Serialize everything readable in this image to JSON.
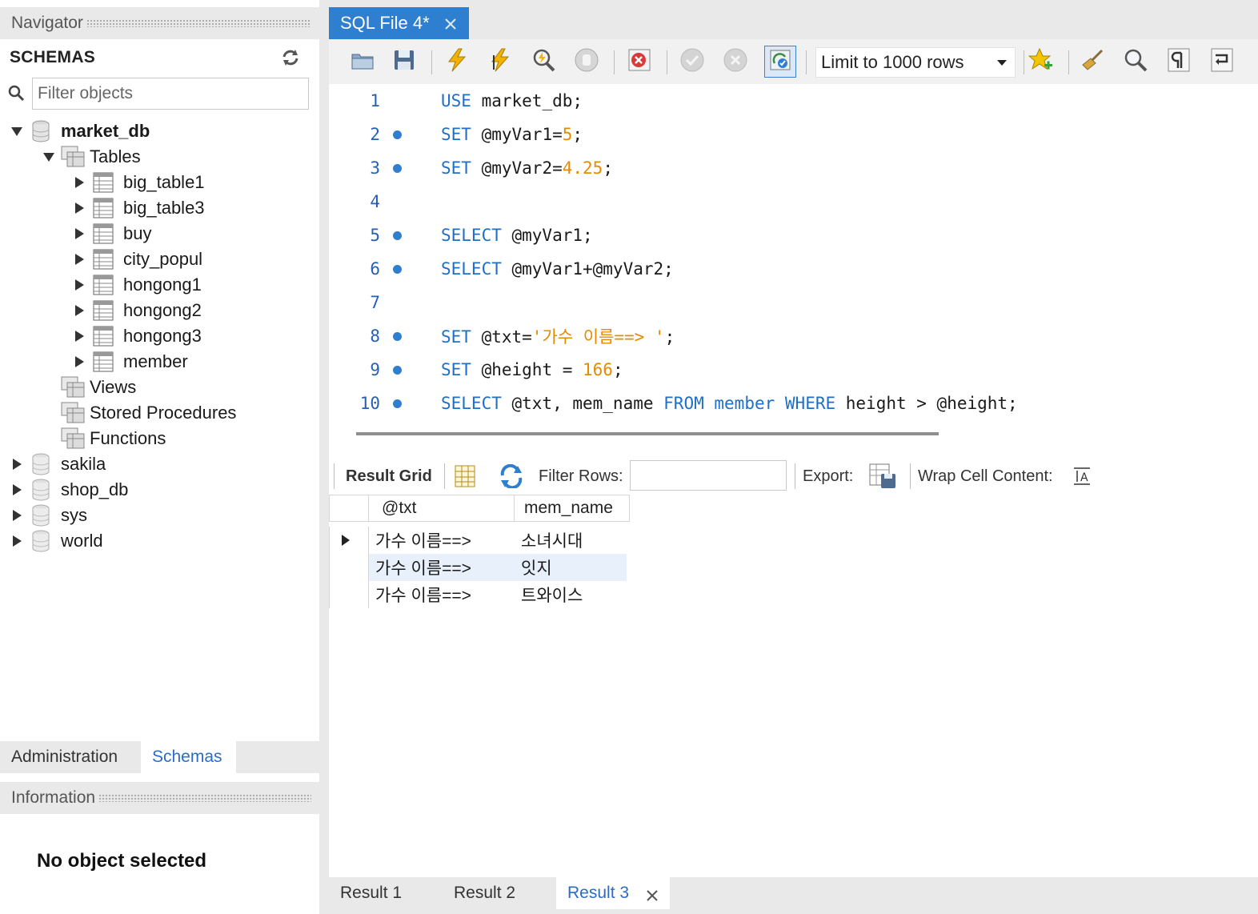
{
  "navigator": {
    "header": "Navigator",
    "schemas_title": "SCHEMAS",
    "filter_placeholder": "Filter objects",
    "tree": {
      "db_market": "market_db",
      "tables_label": "Tables",
      "tables": [
        "big_table1",
        "big_table3",
        "buy",
        "city_popul",
        "hongong1",
        "hongong2",
        "hongong3",
        "member"
      ],
      "views_label": "Views",
      "procs_label": "Stored Procedures",
      "funcs_label": "Functions",
      "other_dbs": [
        "sakila",
        "shop_db",
        "sys",
        "world"
      ]
    },
    "bottom_tabs": {
      "admin": "Administration",
      "schemas": "Schemas"
    },
    "info_header": "Information",
    "info_text": "No object selected"
  },
  "editor_tab": {
    "title": "SQL File 4*"
  },
  "toolbar": {
    "limit": "Limit to 1000 rows"
  },
  "editor": {
    "lines": [
      {
        "n": "1",
        "parts": [
          [
            "kw",
            "USE"
          ],
          [
            "p",
            " market_db;"
          ]
        ],
        "dot": false
      },
      {
        "n": "2",
        "parts": [
          [
            "kw",
            "SET"
          ],
          [
            "p",
            " @myVar1="
          ],
          [
            "num",
            "5"
          ],
          [
            "p",
            ";"
          ]
        ],
        "dot": true
      },
      {
        "n": "3",
        "parts": [
          [
            "kw",
            "SET"
          ],
          [
            "p",
            " @myVar2="
          ],
          [
            "num",
            "4.25"
          ],
          [
            "p",
            ";"
          ]
        ],
        "dot": true
      },
      {
        "n": "4",
        "parts": [],
        "dot": false
      },
      {
        "n": "5",
        "parts": [
          [
            "kw",
            "SELECT"
          ],
          [
            "p",
            " @myVar1;"
          ]
        ],
        "dot": true
      },
      {
        "n": "6",
        "parts": [
          [
            "kw",
            "SELECT"
          ],
          [
            "p",
            " @myVar1+@myVar2;"
          ]
        ],
        "dot": true
      },
      {
        "n": "7",
        "parts": [],
        "dot": false
      },
      {
        "n": "8",
        "parts": [
          [
            "kw",
            "SET"
          ],
          [
            "p",
            " @txt="
          ],
          [
            "str",
            "'가수 이름==> '"
          ],
          [
            "p",
            ";"
          ]
        ],
        "dot": true
      },
      {
        "n": "9",
        "parts": [
          [
            "kw",
            "SET"
          ],
          [
            "p",
            " @height = "
          ],
          [
            "num",
            "166"
          ],
          [
            "p",
            ";"
          ]
        ],
        "dot": true
      },
      {
        "n": "10",
        "parts": [
          [
            "kw",
            "SELECT"
          ],
          [
            "p",
            " @txt, mem_name "
          ],
          [
            "kw",
            "FROM"
          ],
          [
            "p",
            " "
          ],
          [
            "kw",
            "member"
          ],
          [
            "p",
            " "
          ],
          [
            "kw",
            "WHERE"
          ],
          [
            "p",
            " height > @height;"
          ]
        ],
        "dot": true
      }
    ]
  },
  "result_toolbar": {
    "grid_label": "Result Grid",
    "filter_label": "Filter Rows:",
    "export_label": "Export:",
    "wrap_label": "Wrap Cell Content:"
  },
  "grid": {
    "columns": [
      "@txt",
      "mem_name"
    ],
    "rows": [
      [
        "가수 이름==>",
        "소녀시대"
      ],
      [
        "가수 이름==>",
        "잇지"
      ],
      [
        "가수 이름==>",
        "트와이스"
      ]
    ]
  },
  "result_tabs": [
    "Result 1",
    "Result 2",
    "Result 3"
  ],
  "colors": {
    "accent": "#2f7fd1",
    "keyword": "#1f6fc6",
    "literal": "#e68a00"
  }
}
